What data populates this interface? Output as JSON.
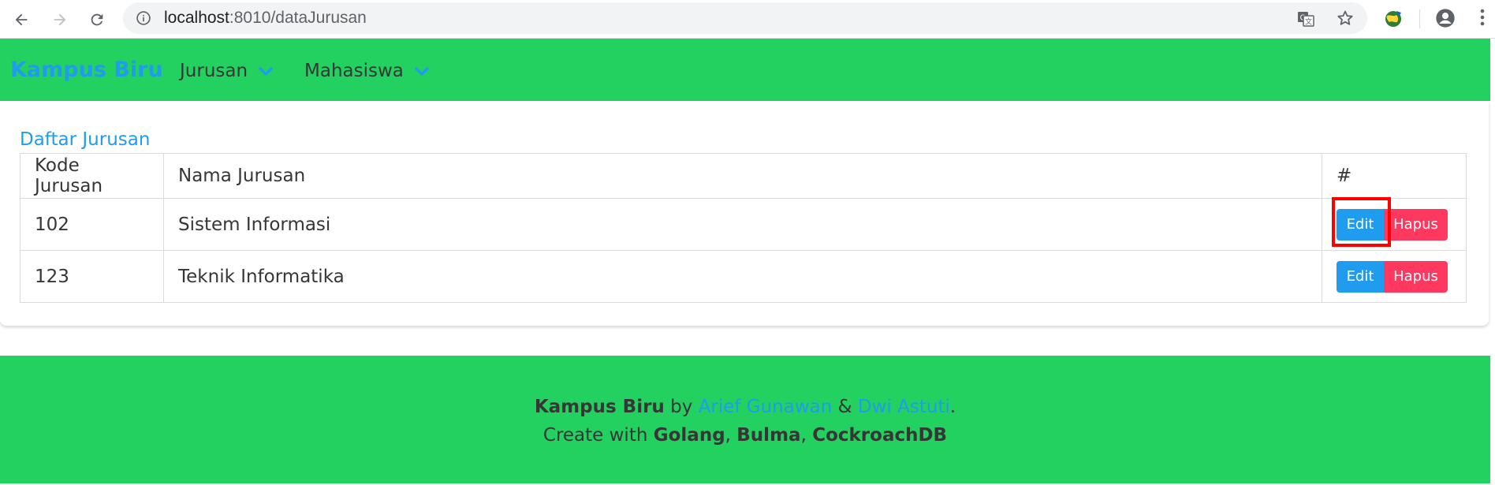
{
  "browser": {
    "url_host": "localhost",
    "url_rest": ":8010/dataJurusan"
  },
  "navbar": {
    "brand": "Kampus Biru",
    "items": [
      {
        "label": "Jurusan"
      },
      {
        "label": "Mahasiswa"
      }
    ]
  },
  "main": {
    "title": "Daftar Jurusan",
    "table": {
      "headers": [
        "Kode Jurusan",
        "Nama Jurusan",
        "#"
      ],
      "rows": [
        {
          "kode": "102",
          "nama": "Sistem Informasi",
          "edit_label": "Edit",
          "hapus_label": "Hapus"
        },
        {
          "kode": "123",
          "nama": "Teknik Informatika",
          "edit_label": "Edit",
          "hapus_label": "Hapus"
        }
      ]
    }
  },
  "footer": {
    "app_name": "Kampus Biru",
    "by": "by",
    "author1": "Arief Gunawan",
    "amp": "&",
    "author2": "Dwi Astuti",
    "period": ".",
    "create_with": "Create with",
    "tech1": "Golang",
    "tech2": "Bulma",
    "tech3": "CockroachDB",
    "comma": ","
  },
  "colors": {
    "primary_green": "#23d160",
    "info_blue": "#209cee",
    "danger_red": "#ff3860",
    "highlight_red": "#ff0000"
  }
}
